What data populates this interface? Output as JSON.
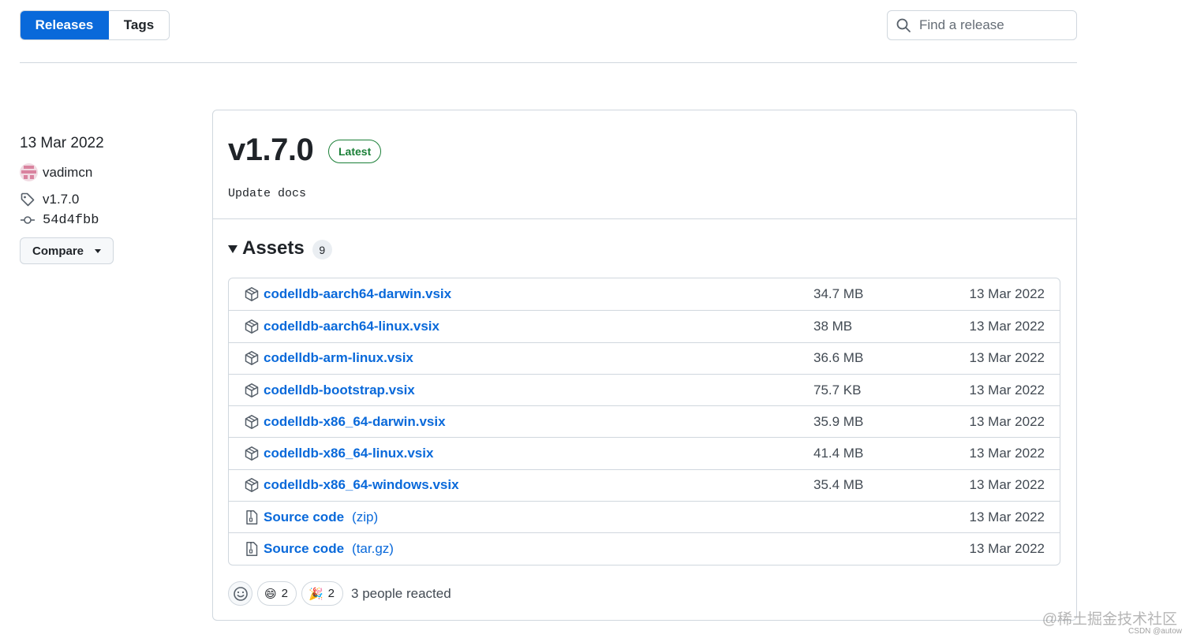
{
  "tabs": [
    {
      "label": "Releases",
      "active": true
    },
    {
      "label": "Tags",
      "active": false
    }
  ],
  "search": {
    "placeholder": "Find a release",
    "value": ""
  },
  "meta": {
    "date": "13 Mar 2022",
    "author": "vadimcn",
    "tag": "v1.7.0",
    "commit": "54d4fbb",
    "compare_label": "Compare"
  },
  "release": {
    "title": "v1.7.0",
    "badge": "Latest",
    "notes": "Update docs",
    "assets_label": "Assets",
    "assets_count": "9",
    "assets": [
      {
        "name": "codelldb-aarch64-darwin.vsix",
        "size": "34.7 MB",
        "date": "13 Mar 2022",
        "icon": "package-icon"
      },
      {
        "name": "codelldb-aarch64-linux.vsix",
        "size": "38 MB",
        "date": "13 Mar 2022",
        "icon": "package-icon"
      },
      {
        "name": "codelldb-arm-linux.vsix",
        "size": "36.6 MB",
        "date": "13 Mar 2022",
        "icon": "package-icon"
      },
      {
        "name": "codelldb-bootstrap.vsix",
        "size": "75.7 KB",
        "date": "13 Mar 2022",
        "icon": "package-icon"
      },
      {
        "name": "codelldb-x86_64-darwin.vsix",
        "size": "35.9 MB",
        "date": "13 Mar 2022",
        "icon": "package-icon"
      },
      {
        "name": "codelldb-x86_64-linux.vsix",
        "size": "41.4 MB",
        "date": "13 Mar 2022",
        "icon": "package-icon"
      },
      {
        "name": "codelldb-x86_64-windows.vsix",
        "size": "35.4 MB",
        "date": "13 Mar 2022",
        "icon": "package-icon"
      },
      {
        "name": "Source code",
        "sub": "(zip)",
        "size": "",
        "date": "13 Mar 2022",
        "icon": "file-zip-icon"
      },
      {
        "name": "Source code",
        "sub": "(tar.gz)",
        "size": "",
        "date": "13 Mar 2022",
        "icon": "file-zip-icon"
      }
    ],
    "reactions": [
      {
        "emoji": "😄",
        "count": "2"
      },
      {
        "emoji": "🎉",
        "count": "2"
      }
    ],
    "reactions_text": "3 people reacted"
  },
  "watermark": {
    "line1": "@稀土掘金技术社区",
    "line2": "CSDN @autow"
  },
  "colors": {
    "accent": "#0969da",
    "success": "#1a7f37",
    "border": "#d0d7de"
  }
}
